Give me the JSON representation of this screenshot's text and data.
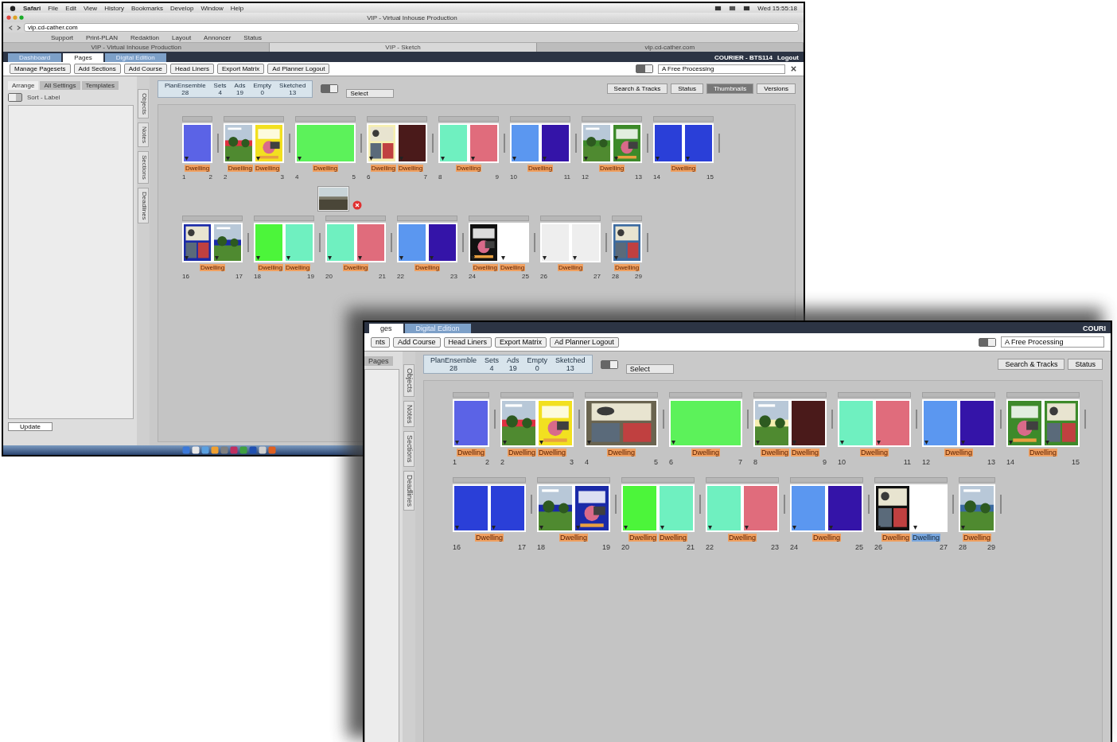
{
  "window_1": {
    "menu_bar": {
      "items": [
        "Safari",
        "File",
        "Edit",
        "View",
        "History",
        "Bookmarks",
        "Develop",
        "Window",
        "Help"
      ],
      "clock": "Wed 15:55:18"
    },
    "browser": {
      "title": "VIP - Virtual Inhouse Production",
      "url": "vip.cd-cather.com",
      "bookmarks": [
        "Support",
        "Print-PLAN",
        "Redaktion",
        "Layout",
        "Annoncer",
        "Status"
      ],
      "tabs": [
        {
          "label": "VIP - Virtual Inhouse Production",
          "selected": false
        },
        {
          "label": "VIP - Sketch",
          "selected": true
        },
        {
          "label": "vip.cd-cather.com",
          "selected": false
        }
      ]
    },
    "app": {
      "nav_tabs": [
        {
          "label": "Dashboard",
          "selected": false
        },
        {
          "label": "Pages",
          "selected": true
        },
        {
          "label": "Digital Edition",
          "selected": false
        }
      ],
      "user": "COURIER - BTS114",
      "logout": "Logout",
      "toolbar_buttons": [
        "Manage Pagesets",
        "Add Sections",
        "Add Course",
        "Head Liners",
        "Export Matrix",
        "Ad Planner Logout"
      ],
      "search": {
        "value": "A Free Processing"
      },
      "toolbar_toggle": {
        "on": true
      },
      "panel_toggle": {
        "on": false
      },
      "layout_toggle": {
        "on": true
      },
      "left_tabs": [
        {
          "label": "Arrange",
          "selected": true
        },
        {
          "label": "All Settings",
          "selected": false
        },
        {
          "label": "Templates",
          "selected": false
        }
      ],
      "toggle_label": "Sort - Label",
      "update_button": "Update",
      "vertical_tabs": [
        "Objects",
        "Notes",
        "Sections",
        "Deadlines"
      ],
      "stats": [
        {
          "label": "PlanEnsemble",
          "value": "28"
        },
        {
          "label": "Sets",
          "value": "4"
        },
        {
          "label": "Ads",
          "value": "19"
        },
        {
          "label": "Empty",
          "value": "0"
        },
        {
          "label": "Sketched",
          "value": "13"
        }
      ],
      "filter": "Select",
      "view_buttons": [
        {
          "label": "Search & Tracks",
          "selected": false
        },
        {
          "label": "Status",
          "selected": false
        },
        {
          "label": "Thumbnails",
          "selected": true
        },
        {
          "label": "Versions",
          "selected": false
        }
      ],
      "rows": [
        [
          {
            "pages": [
              {
                "kind": "color",
                "color": "#5b63e6"
              }
            ],
            "badges": [
              {
                "text": "Dwelling",
                "selected": false
              }
            ],
            "numbers": [
              "1",
              "2"
            ]
          },
          {
            "pages": [
              {
                "kind": "picture",
                "color": "#e03040"
              },
              {
                "kind": "picture",
                "color": "#f2e020"
              }
            ],
            "badges": [
              {
                "text": "Dwelling",
                "selected": false
              },
              {
                "text": "Dwelling",
                "selected": false
              }
            ],
            "numbers": [
              "2",
              "3"
            ]
          },
          {
            "wide": true,
            "pages": [
              {
                "kind": "color",
                "color": "#5cf25a"
              }
            ],
            "badges": [
              {
                "text": "Dwelling",
                "selected": false
              }
            ],
            "numbers": [
              "4",
              "5"
            ]
          },
          {
            "pages": [
              {
                "kind": "picture",
                "color": "#f6efb0"
              },
              {
                "kind": "color",
                "color": "#4a1a1a"
              }
            ],
            "badges": [
              {
                "text": "Dwelling",
                "selected": false
              },
              {
                "text": "Dwelling",
                "selected": false
              }
            ],
            "numbers": [
              "6",
              "7"
            ]
          },
          {
            "pages": [
              {
                "kind": "color",
                "color": "#6ff0c0"
              },
              {
                "kind": "color",
                "color": "#e06c7c"
              }
            ],
            "badges": [
              {
                "text": "Dwelling",
                "selected": false
              }
            ],
            "numbers": [
              "8",
              "9"
            ]
          },
          {
            "pages": [
              {
                "kind": "color",
                "color": "#5b97f0"
              },
              {
                "kind": "color",
                "color": "#3414a8"
              }
            ],
            "badges": [
              {
                "text": "Dwelling",
                "selected": false
              }
            ],
            "numbers": [
              "10",
              "11"
            ]
          },
          {
            "pages": [
              {
                "kind": "picture",
                "color": "#3d8a2a"
              },
              {
                "kind": "picture",
                "color": "#3d8a2a"
              }
            ],
            "badges": [
              {
                "text": "Dwelling",
                "selected": false
              }
            ],
            "numbers": [
              "12",
              "13"
            ]
          },
          {
            "pages": [
              {
                "kind": "color",
                "color": "#2a3fd8"
              },
              {
                "kind": "color",
                "color": "#2a3fd8"
              }
            ],
            "badges": [
              {
                "text": "Dwelling",
                "selected": false
              }
            ],
            "numbers": [
              "14",
              "15"
            ]
          }
        ],
        [
          {
            "pages": [
              {
                "kind": "picture",
                "color": "#1a2aa8"
              },
              {
                "kind": "picture",
                "color": "#1a2aa8"
              }
            ],
            "badges": [
              {
                "text": "Dwelling",
                "selected": false
              }
            ],
            "numbers": [
              "16",
              "17"
            ]
          },
          {
            "pages": [
              {
                "kind": "color",
                "color": "#4cf53a"
              },
              {
                "kind": "color",
                "color": "#6ff0c0"
              }
            ],
            "badges": [
              {
                "text": "Dwelling",
                "selected": false
              },
              {
                "text": "Dwelling",
                "selected": false
              }
            ],
            "numbers": [
              "18",
              "19"
            ]
          },
          {
            "pages": [
              {
                "kind": "color",
                "color": "#6ff0c0"
              },
              {
                "kind": "color",
                "color": "#e06c7c"
              }
            ],
            "badges": [
              {
                "text": "Dwelling",
                "selected": false
              }
            ],
            "numbers": [
              "20",
              "21"
            ]
          },
          {
            "pages": [
              {
                "kind": "color",
                "color": "#5b97f0"
              },
              {
                "kind": "color",
                "color": "#3414a8"
              }
            ],
            "badges": [
              {
                "text": "Dwelling",
                "selected": false
              }
            ],
            "numbers": [
              "22",
              "23"
            ]
          },
          {
            "pages": [
              {
                "kind": "picture",
                "color": "#111111"
              },
              {
                "kind": "color",
                "color": "#ffffff"
              }
            ],
            "badges": [
              {
                "text": "Dwelling",
                "selected": false
              },
              {
                "text": "Dwelling",
                "selected": false
              }
            ],
            "numbers": [
              "24",
              "25"
            ]
          },
          {
            "pages": [
              {
                "kind": "color",
                "color": "#eeeeee"
              },
              {
                "kind": "color",
                "color": "#eeeeee"
              }
            ],
            "badges": [
              {
                "text": "Dwelling",
                "selected": false
              }
            ],
            "numbers": [
              "26",
              "27"
            ]
          },
          {
            "pages": [
              {
                "kind": "picture",
                "color": "#3b6aa0"
              }
            ],
            "badges": [
              {
                "text": "Dwelling",
                "selected": false
              }
            ],
            "numbers": [
              "28",
              "29"
            ]
          }
        ]
      ]
    }
  },
  "window_2": {
    "app": {
      "nav_tabs": [
        {
          "label": "ges",
          "selected": true
        },
        {
          "label": "Digital Edition",
          "selected": false
        }
      ],
      "user": "COURI",
      "toolbar_buttons": [
        "nts",
        "Add Course",
        "Head Liners",
        "Export Matrix",
        "Ad Planner Logout"
      ],
      "search": {
        "value": "A Free Processing"
      },
      "toolbar_toggle": {
        "on": true
      },
      "layout_toggle": {
        "on": true
      },
      "left_tabs": [
        {
          "label": "Pages",
          "selected": false
        }
      ],
      "vertical_tabs": [
        "Objects",
        "Notes",
        "Sections",
        "Deadlines"
      ],
      "stats": [
        {
          "label": "PlanEnsemble",
          "value": "28"
        },
        {
          "label": "Sets",
          "value": "4"
        },
        {
          "label": "Ads",
          "value": "19"
        },
        {
          "label": "Empty",
          "value": "0"
        },
        {
          "label": "Sketched",
          "value": "13"
        }
      ],
      "filter": "Select",
      "view_buttons": [
        {
          "label": "Search & Tracks",
          "selected": false
        },
        {
          "label": "Status",
          "selected": false
        }
      ],
      "rows": [
        [
          {
            "pages": [
              {
                "kind": "color",
                "color": "#5b63e6"
              }
            ],
            "badges": [
              {
                "text": "Dwelling",
                "selected": false
              }
            ],
            "numbers": [
              "1",
              "2"
            ]
          },
          {
            "pages": [
              {
                "kind": "picture",
                "color": "#e03040"
              },
              {
                "kind": "picture",
                "color": "#f2e020"
              }
            ],
            "badges": [
              {
                "text": "Dwelling",
                "selected": false
              },
              {
                "text": "Dwelling",
                "selected": false
              }
            ],
            "numbers": [
              "2",
              "3"
            ]
          },
          {
            "wide": true,
            "pages": [
              {
                "kind": "picture",
                "color": "#6a6450"
              }
            ],
            "badges": [
              {
                "text": "Dwelling",
                "selected": false
              }
            ],
            "numbers": [
              "4",
              "5"
            ]
          },
          {
            "wide": true,
            "pages": [
              {
                "kind": "color",
                "color": "#5cf25a"
              }
            ],
            "badges": [
              {
                "text": "Dwelling",
                "selected": false
              }
            ],
            "numbers": [
              "6",
              "7"
            ]
          },
          {
            "pages": [
              {
                "kind": "picture",
                "color": "#f6efb0"
              },
              {
                "kind": "color",
                "color": "#4a1a1a"
              }
            ],
            "badges": [
              {
                "text": "Dwelling",
                "selected": false
              },
              {
                "text": "Dwelling",
                "selected": false
              }
            ],
            "numbers": [
              "8",
              "9"
            ]
          },
          {
            "pages": [
              {
                "kind": "color",
                "color": "#6ff0c0"
              },
              {
                "kind": "color",
                "color": "#e06c7c"
              }
            ],
            "badges": [
              {
                "text": "Dwelling",
                "selected": false
              }
            ],
            "numbers": [
              "10",
              "11"
            ]
          },
          {
            "pages": [
              {
                "kind": "color",
                "color": "#5b97f0"
              },
              {
                "kind": "color",
                "color": "#3414a8"
              }
            ],
            "badges": [
              {
                "text": "Dwelling",
                "selected": false
              }
            ],
            "numbers": [
              "12",
              "13"
            ]
          },
          {
            "pages": [
              {
                "kind": "picture",
                "color": "#3d8a2a"
              },
              {
                "kind": "picture",
                "color": "#3d8a2a"
              }
            ],
            "badges": [
              {
                "text": "Dwelling",
                "selected": false
              }
            ],
            "numbers": [
              "14",
              "15"
            ]
          }
        ],
        [
          {
            "pages": [
              {
                "kind": "color",
                "color": "#2a3fd8"
              },
              {
                "kind": "color",
                "color": "#2a3fd8"
              }
            ],
            "badges": [
              {
                "text": "Dwelling",
                "selected": false
              }
            ],
            "numbers": [
              "16",
              "17"
            ]
          },
          {
            "pages": [
              {
                "kind": "picture",
                "color": "#1a2aa8"
              },
              {
                "kind": "picture",
                "color": "#1a2aa8"
              }
            ],
            "badges": [
              {
                "text": "Dwelling",
                "selected": false
              }
            ],
            "numbers": [
              "18",
              "19"
            ]
          },
          {
            "pages": [
              {
                "kind": "color",
                "color": "#4cf53a"
              },
              {
                "kind": "color",
                "color": "#6ff0c0"
              }
            ],
            "badges": [
              {
                "text": "Dwelling",
                "selected": false
              },
              {
                "text": "Dwelling",
                "selected": false
              }
            ],
            "numbers": [
              "20",
              "21"
            ]
          },
          {
            "pages": [
              {
                "kind": "color",
                "color": "#6ff0c0"
              },
              {
                "kind": "color",
                "color": "#e06c7c"
              }
            ],
            "badges": [
              {
                "text": "Dwelling",
                "selected": false
              }
            ],
            "numbers": [
              "22",
              "23"
            ]
          },
          {
            "pages": [
              {
                "kind": "color",
                "color": "#5b97f0"
              },
              {
                "kind": "color",
                "color": "#3414a8"
              }
            ],
            "badges": [
              {
                "text": "Dwelling",
                "selected": false
              }
            ],
            "numbers": [
              "24",
              "25"
            ]
          },
          {
            "pages": [
              {
                "kind": "picture",
                "color": "#111111"
              },
              {
                "kind": "color",
                "color": "#ffffff"
              }
            ],
            "badges": [
              {
                "text": "Dwelling",
                "selected": false
              },
              {
                "text": "Dwelling",
                "selected": true
              }
            ],
            "numbers": [
              "26",
              "27"
            ]
          },
          {
            "pages": [
              {
                "kind": "picture",
                "color": "#3b6aa0"
              }
            ],
            "badges": [
              {
                "text": "Dwelling",
                "selected": false
              }
            ],
            "numbers": [
              "28",
              "29"
            ]
          }
        ]
      ]
    }
  }
}
